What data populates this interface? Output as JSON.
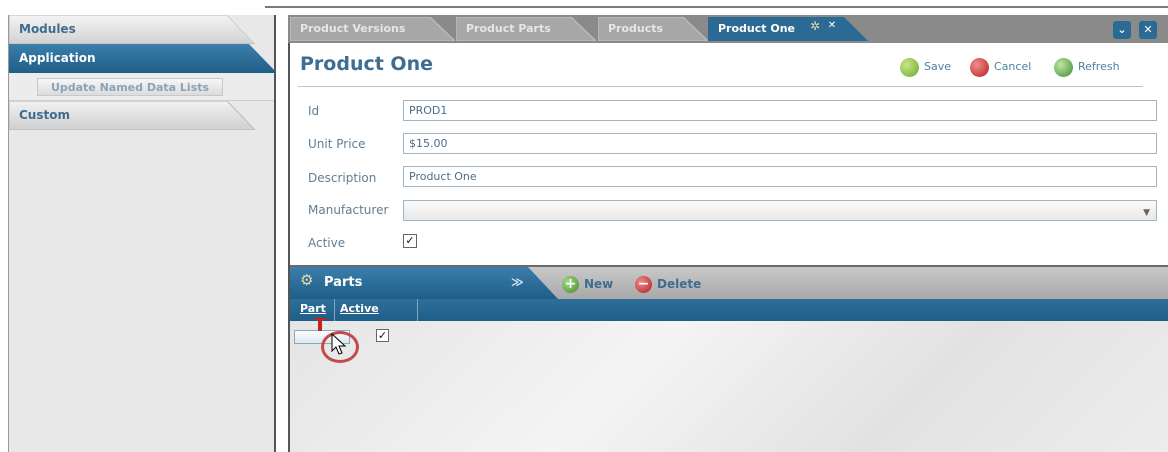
{
  "sidebar": {
    "modules": "Modules",
    "application": "Application",
    "update_named_data_lists": "Update Named Data Lists",
    "custom": "Custom"
  },
  "tabs": [
    {
      "label": "Product Versions"
    },
    {
      "label": "Product Parts"
    },
    {
      "label": "Products"
    },
    {
      "label": "Product One"
    }
  ],
  "form": {
    "title": "Product One",
    "save": "Save",
    "cancel": "Cancel",
    "refresh": "Refresh",
    "fields": {
      "id": {
        "label": "Id",
        "value": "PROD1"
      },
      "unit_price": {
        "label": "Unit Price",
        "value": "$15.00"
      },
      "description": {
        "label": "Description",
        "value": "Product One"
      },
      "manufacturer": {
        "label": "Manufacturer",
        "value": ""
      },
      "active": {
        "label": "Active",
        "checked": true
      }
    }
  },
  "parts": {
    "title": "Parts",
    "new": "New",
    "delete": "Delete",
    "columns": [
      "Part",
      "Active"
    ],
    "rows": [
      {
        "part": "",
        "active": true
      }
    ]
  },
  "colors": {
    "accent": "#2a6a94",
    "title": "#3f6d90",
    "tab_bar": "#8a8a8a"
  }
}
